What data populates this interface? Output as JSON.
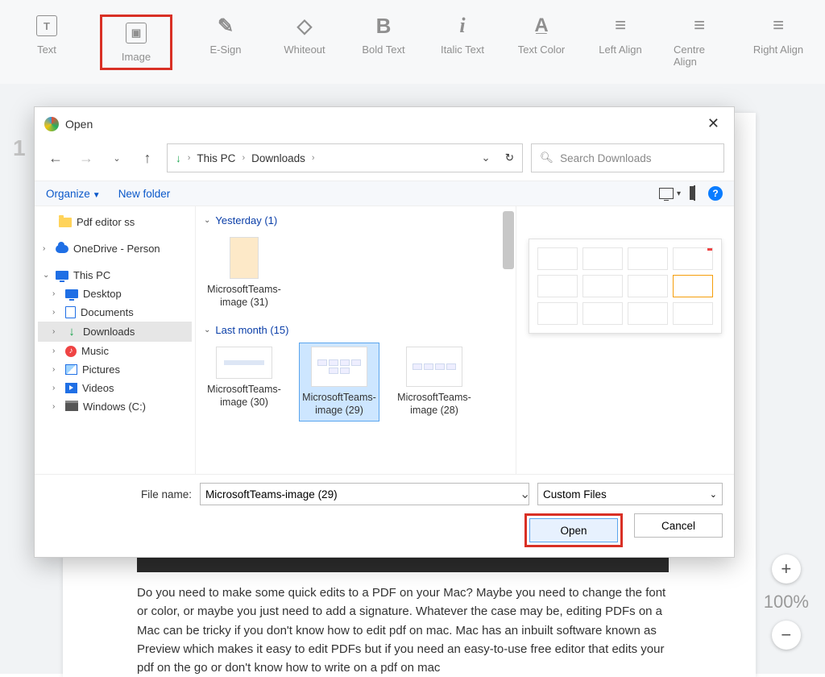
{
  "toolbar": {
    "items": [
      {
        "label": "Text"
      },
      {
        "label": "Image"
      },
      {
        "label": "E-Sign"
      },
      {
        "label": "Whiteout"
      },
      {
        "label": "Bold Text"
      },
      {
        "label": "Italic Text"
      },
      {
        "label": "Text Color"
      },
      {
        "label": "Left Align"
      },
      {
        "label": "Centre Align"
      },
      {
        "label": "Right Align"
      }
    ]
  },
  "page_number": "1",
  "zoom": {
    "percent": "100%"
  },
  "document": {
    "paragraph": "Do you need to make some quick edits to a PDF on your Mac? Maybe you need to change the font or color, or maybe you just need to add a signature. Whatever the case may be, editing PDFs on a Mac can be tricky if you don't know how to edit pdf on mac. Mac has an inbuilt software known as Preview which makes it easy to edit PDFs but if you need an easy-to-use free editor that edits your pdf on the go or don't know how to write on a pdf on mac"
  },
  "dialog": {
    "title": "Open",
    "breadcrumb": {
      "root": "This PC",
      "folder": "Downloads"
    },
    "search_placeholder": "Search Downloads",
    "organize": "Organize",
    "new_folder": "New folder",
    "tree": {
      "pdf_editor": "Pdf editor ss",
      "onedrive": "OneDrive - Person",
      "this_pc": "This PC",
      "desktop": "Desktop",
      "documents": "Documents",
      "downloads": "Downloads",
      "music": "Music",
      "pictures": "Pictures",
      "videos": "Videos",
      "windows_c": "Windows (C:)"
    },
    "groups": {
      "yesterday": {
        "label": "Yesterday (1)",
        "items": [
          {
            "name": "MicrosoftTeams-image (31)"
          }
        ]
      },
      "last_month": {
        "label": "Last month (15)",
        "items": [
          {
            "name": "MicrosoftTeams-image (30)"
          },
          {
            "name": "MicrosoftTeams-image (29)"
          },
          {
            "name": "MicrosoftTeams-image (28)"
          }
        ]
      }
    },
    "file_name_label": "File name:",
    "file_name_value": "MicrosoftTeams-image (29)",
    "file_type": "Custom Files",
    "open_btn": "Open",
    "cancel_btn": "Cancel"
  }
}
